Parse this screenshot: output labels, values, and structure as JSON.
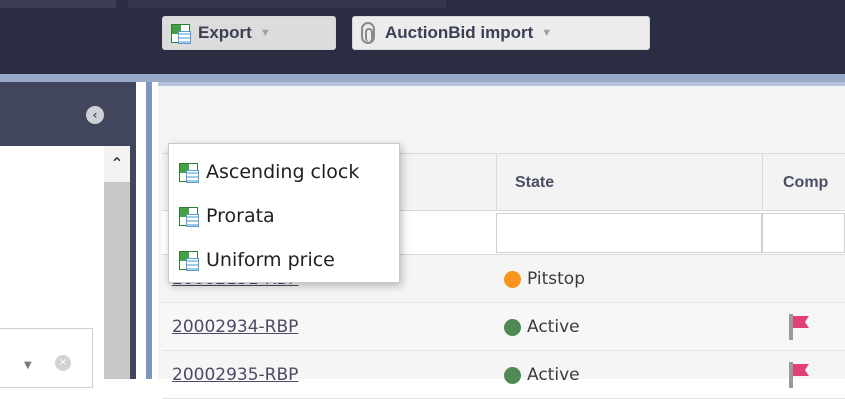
{
  "toolbar": {
    "export_label": "Export",
    "auction_import_label": "AuctionBid import"
  },
  "export_menu": {
    "items": [
      {
        "label": "Ascending clock",
        "icon": "excel-icon"
      },
      {
        "label": "Prorata",
        "icon": "excel-icon"
      },
      {
        "label": "Uniform price",
        "icon": "excel-icon"
      }
    ]
  },
  "table": {
    "columns": [
      "",
      "State",
      "Comp"
    ],
    "rows": [
      {
        "id": "20002131-RBP",
        "state": "Pitstop",
        "state_color": "#f7941d",
        "flag": false
      },
      {
        "id": "20002934-RBP",
        "state": "Active",
        "state_color": "#4f8a55",
        "flag": true
      },
      {
        "id": "20002935-RBP",
        "state": "Active",
        "state_color": "#4f8a55",
        "flag": true
      }
    ]
  },
  "colors": {
    "topbar": "#2b2e43",
    "panel_header": "#42465d",
    "accent_border": "#7e95be",
    "flag": "#e0407a"
  }
}
